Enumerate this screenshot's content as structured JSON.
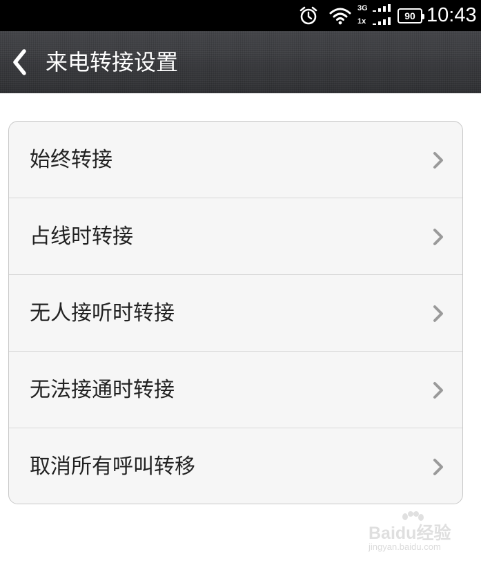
{
  "status_bar": {
    "time": "10:43",
    "battery_level": "90",
    "network_top": "3G",
    "network_bottom": "1x",
    "icons": [
      "alarm-icon",
      "wifi-icon",
      "signal-3g-icon",
      "signal-1x-icon",
      "battery-icon"
    ]
  },
  "header": {
    "title": "来电转接设置",
    "back_icon": "chevron-left-icon"
  },
  "settings": {
    "items": [
      {
        "label": "始终转接"
      },
      {
        "label": "占线时转接"
      },
      {
        "label": "无人接听时转接"
      },
      {
        "label": "无法接通时转接"
      },
      {
        "label": "取消所有呼叫转移"
      }
    ],
    "item_icon": "chevron-right-icon"
  },
  "watermark": {
    "main": "Baidu经验",
    "sub": "jingyan.baidu.com"
  },
  "colors": {
    "status_bar": "#000000",
    "titlebar": "#3a3b3d",
    "group_background": "#f6f6f6",
    "group_border": "#c8c8c8",
    "label_text": "#222222",
    "chevron": "#9a9a9a"
  }
}
